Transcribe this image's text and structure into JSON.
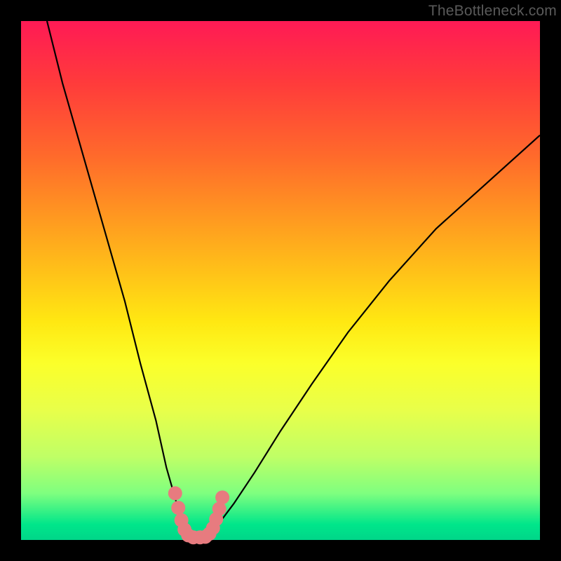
{
  "watermark": "TheBottleneck.com",
  "chart_data": {
    "type": "line",
    "title": "",
    "xlabel": "",
    "ylabel": "",
    "xlim": [
      0,
      100
    ],
    "ylim": [
      0,
      100
    ],
    "series": [
      {
        "name": "bottleneck-curve",
        "x": [
          5,
          8,
          12,
          16,
          20,
          23,
          26,
          28,
          30,
          31,
          32,
          33,
          34,
          36,
          38,
          41,
          45,
          50,
          56,
          63,
          71,
          80,
          90,
          100
        ],
        "values": [
          100,
          88,
          74,
          60,
          46,
          34,
          23,
          14,
          7,
          3,
          1,
          0,
          0,
          1,
          3,
          7,
          13,
          21,
          30,
          40,
          50,
          60,
          69,
          78
        ]
      }
    ],
    "markers": {
      "name": "selected-range",
      "color": "#e77b7f",
      "points": [
        {
          "x": 29.7,
          "y": 9.0
        },
        {
          "x": 30.3,
          "y": 6.2
        },
        {
          "x": 30.9,
          "y": 3.8
        },
        {
          "x": 31.5,
          "y": 2.0
        },
        {
          "x": 32.2,
          "y": 0.9
        },
        {
          "x": 33.2,
          "y": 0.5
        },
        {
          "x": 34.5,
          "y": 0.5
        },
        {
          "x": 35.5,
          "y": 0.6
        },
        {
          "x": 36.3,
          "y": 1.2
        },
        {
          "x": 37.0,
          "y": 2.3
        },
        {
          "x": 37.6,
          "y": 4.0
        },
        {
          "x": 38.2,
          "y": 6.0
        },
        {
          "x": 38.8,
          "y": 8.2
        }
      ]
    },
    "gradient_stops": [
      {
        "pos": 0,
        "color": "#ff1a55"
      },
      {
        "pos": 12,
        "color": "#ff3b3b"
      },
      {
        "pos": 26,
        "color": "#ff6a2b"
      },
      {
        "pos": 38,
        "color": "#ff9920"
      },
      {
        "pos": 49,
        "color": "#ffc418"
      },
      {
        "pos": 58,
        "color": "#ffe812"
      },
      {
        "pos": 66,
        "color": "#fbff2a"
      },
      {
        "pos": 75,
        "color": "#e8ff4a"
      },
      {
        "pos": 84,
        "color": "#bfff66"
      },
      {
        "pos": 91,
        "color": "#7fff7f"
      },
      {
        "pos": 97,
        "color": "#00e68a"
      },
      {
        "pos": 100,
        "color": "#00d689"
      }
    ]
  }
}
